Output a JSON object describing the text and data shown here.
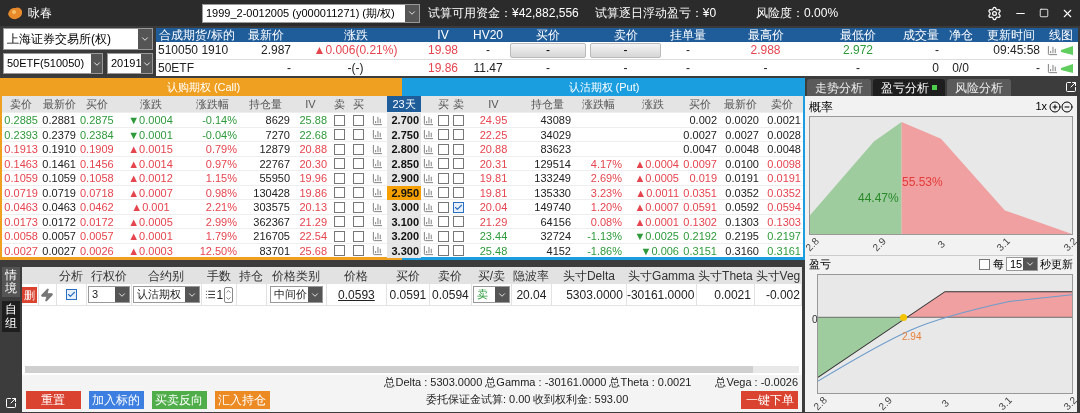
{
  "app": {
    "title": "咏春"
  },
  "account": {
    "value": "1999_2-0012005 (y000011271) (期/权)"
  },
  "summary": [
    "试算可用资金：¥42,882,556",
    "试算逐日浮动盈亏：¥0",
    "风险度：0.00%"
  ],
  "selectors": {
    "exchange": "上海证券交易所(权)",
    "underlying": "50ETF(510050)",
    "month": "20191"
  },
  "quote": {
    "columns": [
      "合成期货/标的",
      "最新价",
      "涨跌",
      "IV",
      "HV20",
      "买价",
      "卖价",
      "挂单量",
      "最高价",
      "最低价",
      "成交量",
      "净仓",
      "更新时间",
      "线图"
    ],
    "rows": [
      {
        "kind": "tradable",
        "name": "510050 1910",
        "last": "2.987",
        "change": {
          "text": "▲0.006(0.21%)",
          "up": true
        },
        "iv": {
          "text": "19.98",
          "up": true
        },
        "hv20": "-",
        "bid": "-",
        "ask": "-",
        "pending": "-",
        "high": {
          "text": "2.988",
          "up": true
        },
        "low": {
          "text": "2.972",
          "down": true
        },
        "volume": "-",
        "time": "09:45:58"
      },
      {
        "kind": "index",
        "name": "50ETF",
        "last": "-",
        "change": "-(-)",
        "iv": {
          "text": "19.86",
          "up": true
        },
        "hv20": "11.47",
        "bid": "-",
        "ask": "-",
        "pending": "-",
        "high": "-",
        "low": "-",
        "volume": "0",
        "net": "0/0",
        "time": "-"
      }
    ]
  },
  "chain": {
    "call_title": "认购期权 (Call)",
    "put_title": "认沽期权 (Put)",
    "days": "23天",
    "call_columns": [
      "卖价",
      "最新价",
      "买价",
      "涨跌",
      "涨跌幅",
      "持仓量",
      "IV",
      "卖",
      "买"
    ],
    "put_columns": [
      "买",
      "卖",
      "IV",
      "持仓量",
      "涨跌幅",
      "涨跌",
      "买价",
      "最新价",
      "卖价"
    ],
    "rows": [
      {
        "strike": "2.700",
        "selected": false,
        "call": {
          "ask": "0.2885",
          "last": "0.2881",
          "bid": "0.2875",
          "change": "▼0.0004",
          "pct": "-0.14%",
          "oi": "8629",
          "iv": "25.88",
          "up": false,
          "down": true,
          "sell": false,
          "buy": false
        },
        "put": {
          "buy": false,
          "sell": false,
          "iv": "24.95",
          "oi": "43089",
          "bid": "0.002",
          "last": "0.0020",
          "ask": "0.0021",
          "up": false,
          "down": false
        }
      },
      {
        "strike": "2.750",
        "selected": false,
        "call": {
          "ask": "0.2393",
          "last": "0.2379",
          "bid": "0.2384",
          "change": "▼0.0001",
          "pct": "-0.04%",
          "oi": "7270",
          "iv": "22.68",
          "up": false,
          "down": true,
          "sell": false,
          "buy": false
        },
        "put": {
          "buy": false,
          "sell": false,
          "iv": "22.25",
          "oi": "34029",
          "bid": "0.0027",
          "last": "0.0027",
          "ask": "0.0028",
          "up": false,
          "down": false
        }
      },
      {
        "strike": "2.800",
        "selected": false,
        "call": {
          "ask": "0.1913",
          "last": "0.1910",
          "bid": "0.1909",
          "change": "▲0.0015",
          "pct": "0.79%",
          "oi": "12879",
          "iv": "20.88",
          "up": true,
          "down": false,
          "sell": false,
          "buy": false
        },
        "put": {
          "buy": false,
          "sell": false,
          "iv": "20.88",
          "oi": "83623",
          "bid": "0.0047",
          "last": "0.0048",
          "ask": "0.0048",
          "up": false,
          "down": false
        }
      },
      {
        "strike": "2.850",
        "selected": false,
        "call": {
          "ask": "0.1463",
          "last": "0.1461",
          "bid": "0.1456",
          "change": "▲0.0014",
          "pct": "0.97%",
          "oi": "22767",
          "iv": "20.30",
          "up": true,
          "down": false,
          "sell": false,
          "buy": false
        },
        "put": {
          "buy": false,
          "sell": false,
          "iv": "20.31",
          "oi": "129514",
          "pct": "4.17%",
          "change": "▲0.0004",
          "bid": "0.0097",
          "last": "0.0100",
          "ask": "0.0098",
          "up": true,
          "down": false
        }
      },
      {
        "strike": "2.900",
        "selected": false,
        "call": {
          "ask": "0.1059",
          "last": "0.1059",
          "bid": "0.1058",
          "change": "▲0.0012",
          "pct": "1.15%",
          "oi": "55950",
          "iv": "19.96",
          "up": true,
          "down": false,
          "sell": false,
          "buy": false
        },
        "put": {
          "buy": false,
          "sell": false,
          "iv": "19.81",
          "oi": "133249",
          "pct": "2.69%",
          "change": "▲0.0005",
          "bid": "0.019",
          "last": "0.0191",
          "ask": "0.0191",
          "up": true,
          "down": false
        }
      },
      {
        "strike": "2.950",
        "selected": true,
        "call": {
          "ask": "0.0719",
          "last": "0.0719",
          "bid": "0.0718",
          "change": "▲0.0007",
          "pct": "0.98%",
          "oi": "130428",
          "iv": "19.86",
          "up": true,
          "down": false,
          "sell": false,
          "buy": false
        },
        "put": {
          "buy": false,
          "sell": false,
          "iv": "19.81",
          "oi": "135330",
          "pct": "3.23%",
          "change": "▲0.0011",
          "bid": "0.0351",
          "last": "0.0352",
          "ask": "0.0352",
          "up": true,
          "down": false
        }
      },
      {
        "strike": "3.000",
        "selected": false,
        "call": {
          "ask": "0.0463",
          "last": "0.0463",
          "bid": "0.0462",
          "change": "▲0.001",
          "pct": "2.21%",
          "oi": "303575",
          "iv": "20.13",
          "up": true,
          "down": false,
          "sell": false,
          "buy": false
        },
        "put": {
          "buy": false,
          "sell": true,
          "iv": "20.04",
          "oi": "149740",
          "pct": "1.20%",
          "change": "▲0.0007",
          "bid": "0.0591",
          "last": "0.0592",
          "ask": "0.0594",
          "up": true,
          "down": false
        }
      },
      {
        "strike": "3.100",
        "selected": false,
        "call": {
          "ask": "0.0173",
          "last": "0.0172",
          "bid": "0.0172",
          "change": "▲0.0005",
          "pct": "2.99%",
          "oi": "362367",
          "iv": "21.29",
          "up": true,
          "down": false,
          "sell": false,
          "buy": false
        },
        "put": {
          "buy": false,
          "sell": false,
          "iv": "21.29",
          "oi": "64156",
          "pct": "0.08%",
          "change": "▲0.0001",
          "bid": "0.1302",
          "last": "0.1303",
          "ask": "0.1303",
          "up": true,
          "down": false
        }
      },
      {
        "strike": "3.200",
        "selected": false,
        "call": {
          "ask": "0.0058",
          "last": "0.0057",
          "bid": "0.0057",
          "change": "▲0.0001",
          "pct": "1.79%",
          "oi": "216705",
          "iv": "22.54",
          "up": true,
          "down": false,
          "sell": false,
          "buy": false
        },
        "put": {
          "buy": false,
          "sell": false,
          "iv": "23.44",
          "oi": "32724",
          "pct": "-1.13%",
          "change": "▼0.0025",
          "bid": "0.2192",
          "last": "0.2195",
          "ask": "0.2197",
          "up": false,
          "down": true
        }
      },
      {
        "strike": "3.300",
        "selected": false,
        "call": {
          "ask": "0.0027",
          "last": "0.0027",
          "bid": "0.0026",
          "change": "▲0.0003",
          "pct": "12.50%",
          "oi": "83701",
          "iv": "25.68",
          "up": true,
          "down": false,
          "sell": false,
          "buy": false
        },
        "put": {
          "buy": false,
          "sell": false,
          "iv": "25.48",
          "oi": "4152",
          "pct": "-1.86%",
          "change": "▼0.006",
          "bid": "0.3151",
          "last": "0.3160",
          "ask": "0.3161",
          "up": false,
          "down": true
        }
      }
    ]
  },
  "side_tabs": [
    {
      "label": "情境",
      "selected": false
    },
    {
      "label": "自组",
      "selected": true
    }
  ],
  "legs": {
    "columns": [
      "分析",
      "行权价",
      "合约别",
      "手数",
      "持仓",
      "价格类别",
      "价格",
      "买价",
      "卖价",
      "买/卖",
      "隐波率",
      "头寸Delta",
      "头寸Gamma",
      "头寸Theta",
      "头寸Veg"
    ],
    "rows": [
      {
        "delete": "删",
        "analyze": true,
        "strike": "3",
        "type": "认沽期权",
        "qty": "1",
        "price_type": "中间价",
        "price": "0.0593",
        "bid": "0.0591",
        "ask": "0.0594",
        "side": "卖",
        "iv": "20.04",
        "delta": "5303.0000",
        "gamma": "-30161.0000",
        "theta": "0.0021",
        "vega": "-0.002"
      }
    ],
    "totals": "总Delta : 5303.0000 总Gamma : -30161.0000 总Theta : 0.0021",
    "total_vega": "总Vega : -0.0026",
    "margin": "委托保证金试算: 0.00 收到权利金: 593.00",
    "buttons": [
      {
        "label": "重置",
        "kind": "red"
      },
      {
        "label": "加入标的",
        "kind": "blue"
      },
      {
        "label": "买卖反向",
        "kind": "green"
      },
      {
        "label": "汇入持仓",
        "kind": "orange"
      }
    ],
    "submit": "一键下单"
  },
  "analysis": {
    "tabs": [
      {
        "label": "走势分析",
        "selected": false
      },
      {
        "label": "盈亏分析",
        "selected": true
      },
      {
        "label": "风险分析",
        "selected": false
      }
    ],
    "probability": {
      "title": "概率",
      "zoom": "1x",
      "below": "44.47%",
      "above": "55.53%",
      "ticks": [
        "2.8",
        "2.9",
        "3",
        "3.1",
        "3.2"
      ]
    },
    "pnl": {
      "title": "盈亏",
      "auto_refresh": false,
      "every": "每",
      "interval": "15",
      "unit": "秒更新",
      "zero": "0",
      "breakeven": "2.94",
      "ticks": [
        "2.8",
        "2.9",
        "3",
        "3.1",
        "3.2"
      ]
    }
  }
}
